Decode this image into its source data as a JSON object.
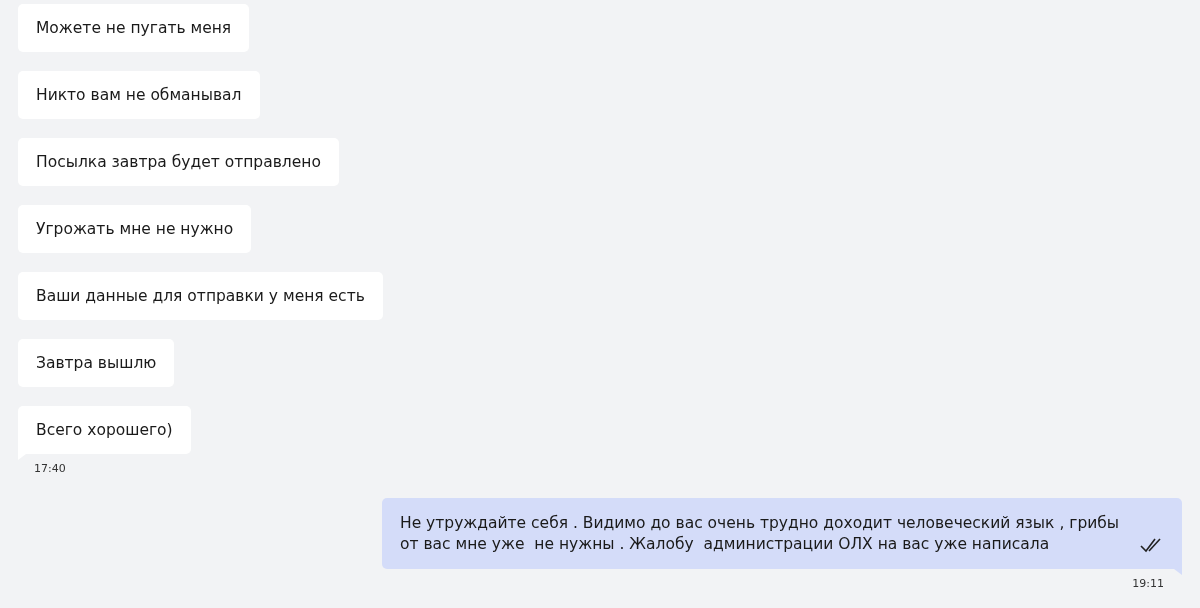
{
  "messages": [
    {
      "kind": "incoming",
      "text": "Можете не пугать меня"
    },
    {
      "kind": "incoming",
      "text": "Никто вам не обманывал"
    },
    {
      "kind": "incoming",
      "text": "Посылка завтра будет отправлено"
    },
    {
      "kind": "incoming",
      "text": "Угрожать мне не нужно"
    },
    {
      "kind": "incoming",
      "text": "Ваши данные для отправки у меня есть"
    },
    {
      "kind": "incoming",
      "text": "Завтра вышлю"
    },
    {
      "kind": "incoming",
      "text": "Всего хорошего)",
      "time": "17:40"
    },
    {
      "kind": "outgoing",
      "text": "Не утруждайте себя . Видимо до вас очень трудно доходит человеческий язык , грибы от вас мне уже  не нужны . Жалобу  администрации ОЛХ на вас уже написала",
      "read": true,
      "time": "19:11"
    }
  ]
}
